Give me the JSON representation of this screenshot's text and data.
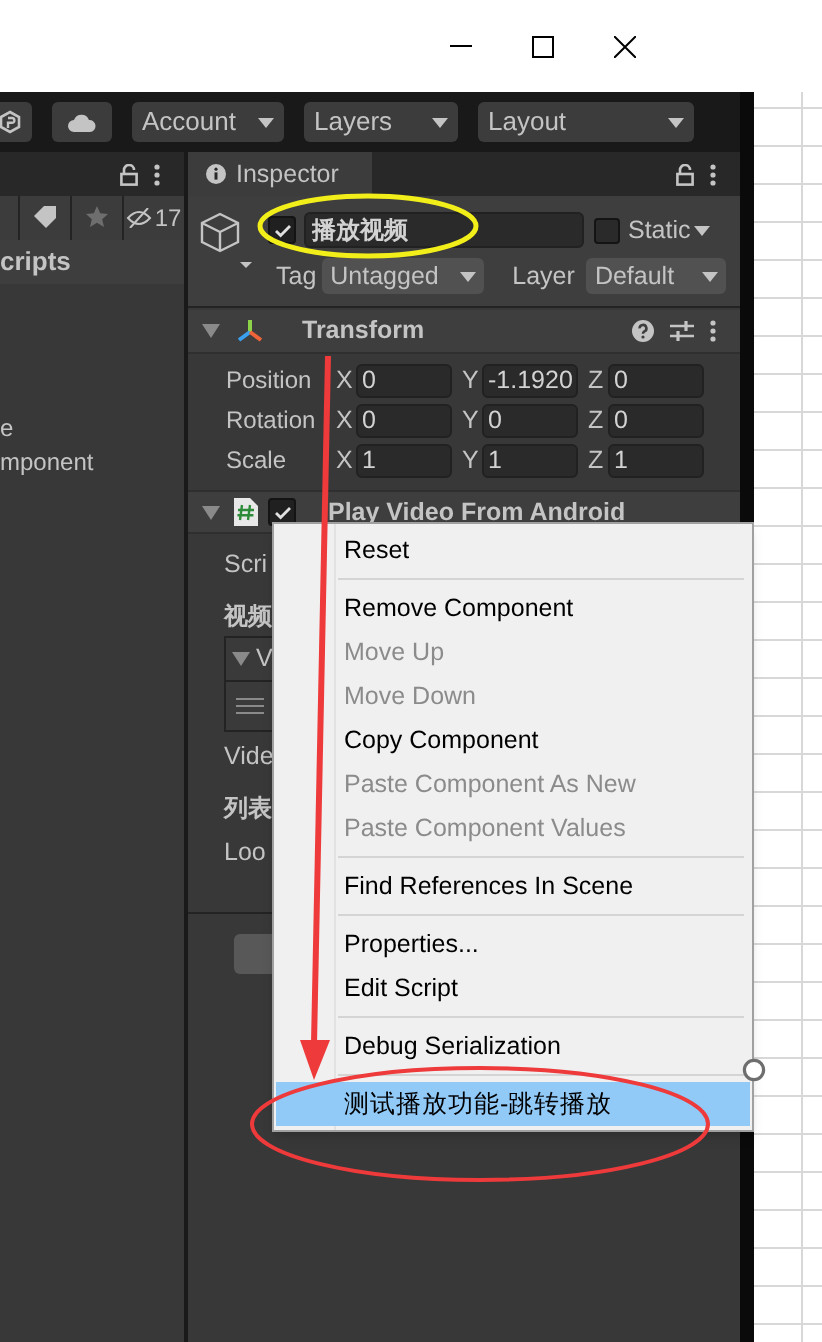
{
  "toolbar": {
    "buttons": [
      "Account",
      "Layers",
      "Layout"
    ]
  },
  "left_panel": {
    "hidden_count": "17",
    "header": "cripts",
    "items": [
      "e",
      "mponent"
    ]
  },
  "inspector": {
    "tab": "Inspector",
    "object": {
      "active": true,
      "name": "播放视频",
      "static": false,
      "static_label": "Static",
      "tag_label": "Tag",
      "tag": "Untagged",
      "layer_label": "Layer",
      "layer": "Default"
    },
    "transform": {
      "title": "Transform",
      "expanded": true,
      "rows": [
        {
          "label": "Position",
          "fields": [
            {
              "axis": "X",
              "value": "0"
            },
            {
              "axis": "Y",
              "value": "-1.1920"
            },
            {
              "axis": "Z",
              "value": "0"
            }
          ]
        },
        {
          "label": "Rotation",
          "fields": [
            {
              "axis": "X",
              "value": "0"
            },
            {
              "axis": "Y",
              "value": "0"
            },
            {
              "axis": "Z",
              "value": "0"
            }
          ]
        },
        {
          "label": "Scale",
          "fields": [
            {
              "axis": "X",
              "value": "1"
            },
            {
              "axis": "Y",
              "value": "1"
            },
            {
              "axis": "Z",
              "value": "1"
            }
          ]
        }
      ]
    },
    "script_component": {
      "title": "Play Video From Android",
      "enabled": true,
      "expanded": true,
      "fields": [
        {
          "kind": "label",
          "text": "Scri"
        },
        {
          "kind": "header",
          "text": "视频"
        },
        {
          "kind": "list",
          "text": "V"
        },
        {
          "kind": "label",
          "text": "Vide"
        },
        {
          "kind": "header",
          "text": "列表"
        },
        {
          "kind": "label",
          "text": "Loo"
        }
      ]
    }
  },
  "context_menu": {
    "groups": [
      [
        {
          "label": "Reset",
          "disabled": false,
          "selected": false
        }
      ],
      [
        {
          "label": "Remove Component",
          "disabled": false,
          "selected": false
        },
        {
          "label": "Move Up",
          "disabled": true,
          "selected": false
        },
        {
          "label": "Move Down",
          "disabled": true,
          "selected": false
        },
        {
          "label": "Copy Component",
          "disabled": false,
          "selected": false
        },
        {
          "label": "Paste Component As New",
          "disabled": true,
          "selected": false
        },
        {
          "label": "Paste Component Values",
          "disabled": true,
          "selected": false
        }
      ],
      [
        {
          "label": "Find References In Scene",
          "disabled": false,
          "selected": false
        }
      ],
      [
        {
          "label": "Properties...",
          "disabled": false,
          "selected": false
        },
        {
          "label": "Edit Script",
          "disabled": false,
          "selected": false
        }
      ],
      [
        {
          "label": "Debug Serialization",
          "disabled": false,
          "selected": false
        }
      ],
      [
        {
          "label": "测试播放功能-跳转播放",
          "disabled": false,
          "selected": true
        }
      ]
    ]
  }
}
